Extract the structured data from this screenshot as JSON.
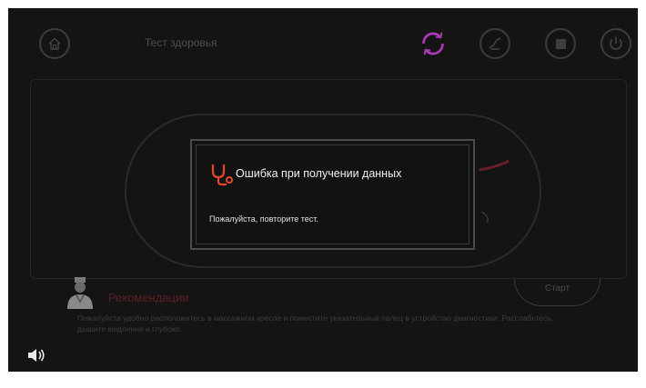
{
  "header": {
    "title": "Тест здоровья",
    "home_icon": "home-icon",
    "sync_icon": "sync-icon",
    "massage_icon": "massage-chair-icon",
    "stop_icon": "stop-icon",
    "power_icon": "power-icon",
    "accent_color": "#a43bb0"
  },
  "dialog": {
    "icon": "stethoscope-icon",
    "title": "Ошибка при получении данных",
    "message": "Пожалуйста, повторите тест.",
    "icon_color": "#e04a2a"
  },
  "recommendations": {
    "icon": "doctor-icon",
    "title": "Рекомендации",
    "text": "Пожалуйста удобно расположитесь в массажном кресле и поместите указательный палец в устройство диагностики. Расслабьтесь, дышите медленно и глубоко."
  },
  "start_button": {
    "label": "Старт"
  },
  "sound": {
    "icon": "speaker-icon"
  }
}
